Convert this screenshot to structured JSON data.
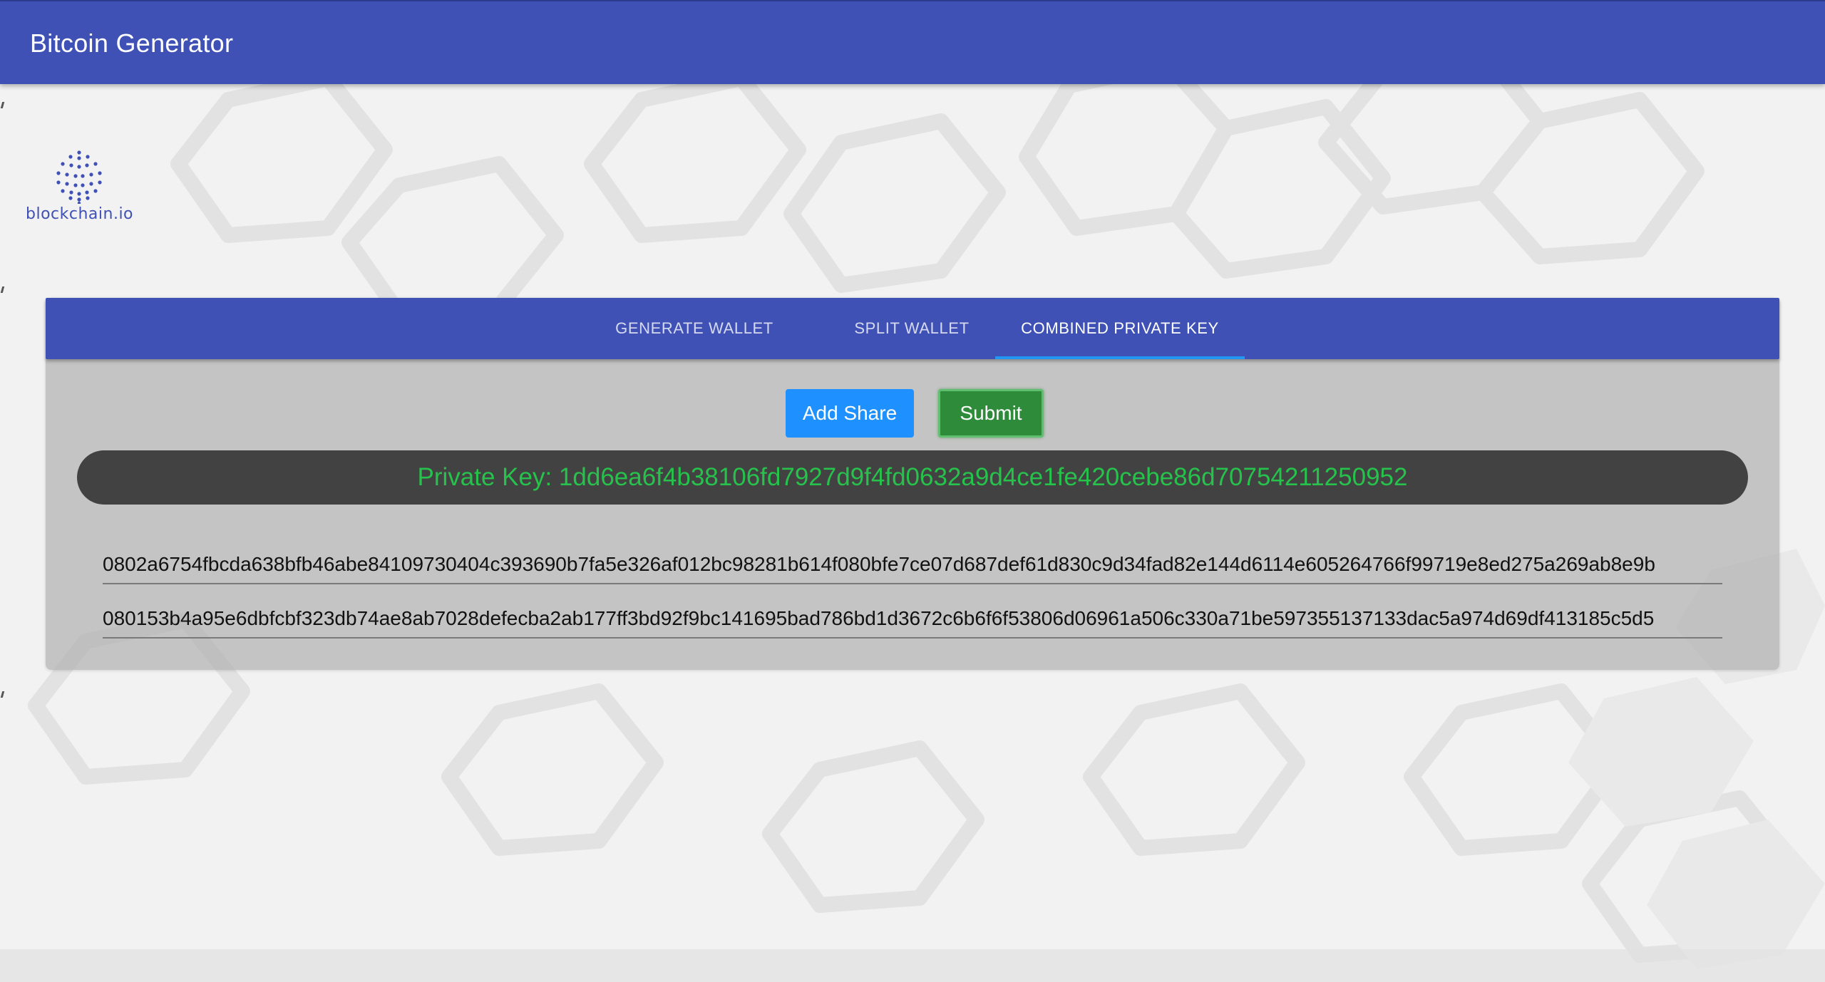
{
  "app": {
    "title": "Bitcoin Generator"
  },
  "logo": {
    "text": "blockchain.io",
    "icon": "dot-sphere-icon",
    "color": "#3f51b5"
  },
  "tabs": [
    {
      "label": "GENERATE WALLET",
      "active": false
    },
    {
      "label": "SPLIT WALLET",
      "active": false
    },
    {
      "label": "COMBINED PRIVATE KEY",
      "active": true
    }
  ],
  "actions": {
    "add_share_label": "Add Share",
    "submit_label": "Submit"
  },
  "result": {
    "text": "Private Key: 1dd6ea6f4b38106fd7927d9f4fd0632a9d4ce1fe420cebe86d70754211250952",
    "color": "#27c24c"
  },
  "shares": [
    "0802a6754fbcda638bfb46abe84109730404c393690b7fa5e326af012bc98281b614f080bfe7ce07d687def61d830c9d34fad82e144d6114e605264766f99719e8ed275a269ab8e9b",
    "080153b4a95e6dbfcbf323db74ae8ab7028defecba2ab177ff3bd92f9bc141695bad786bd1d3672c6b6f6f53806d06961a506c330a71be597355137133dac5a974d69df413185c5d5"
  ],
  "colors": {
    "primary": "#3f51b5",
    "tab_indicator": "#2196f3",
    "add_button": "#1e90ff",
    "submit_button": "#2e8b3a"
  }
}
